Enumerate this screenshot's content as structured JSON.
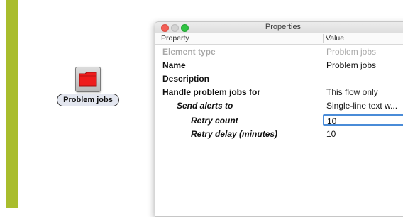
{
  "flow_element": {
    "label": "Problem jobs",
    "icon": "red-folder-icon"
  },
  "window": {
    "title": "Properties",
    "columns": {
      "property": "Property",
      "value": "Value"
    },
    "rows": [
      {
        "property": "Element type",
        "value": "Problem jobs",
        "disabled": true
      },
      {
        "property": "Name",
        "value": "Problem jobs"
      },
      {
        "property": "Description",
        "value": ""
      },
      {
        "property": "Handle problem jobs for",
        "value": "This flow only"
      },
      {
        "property": "Send alerts to",
        "value": "Single-line text w..."
      },
      {
        "property": "Retry count",
        "value": "10",
        "editing": true
      },
      {
        "property": "Retry delay (minutes)",
        "value": "10"
      }
    ]
  },
  "colors": {
    "left_bar": "#a9bd2d",
    "folder_red": "#ee1c1c",
    "focus_ring": "#4a8cd8"
  }
}
